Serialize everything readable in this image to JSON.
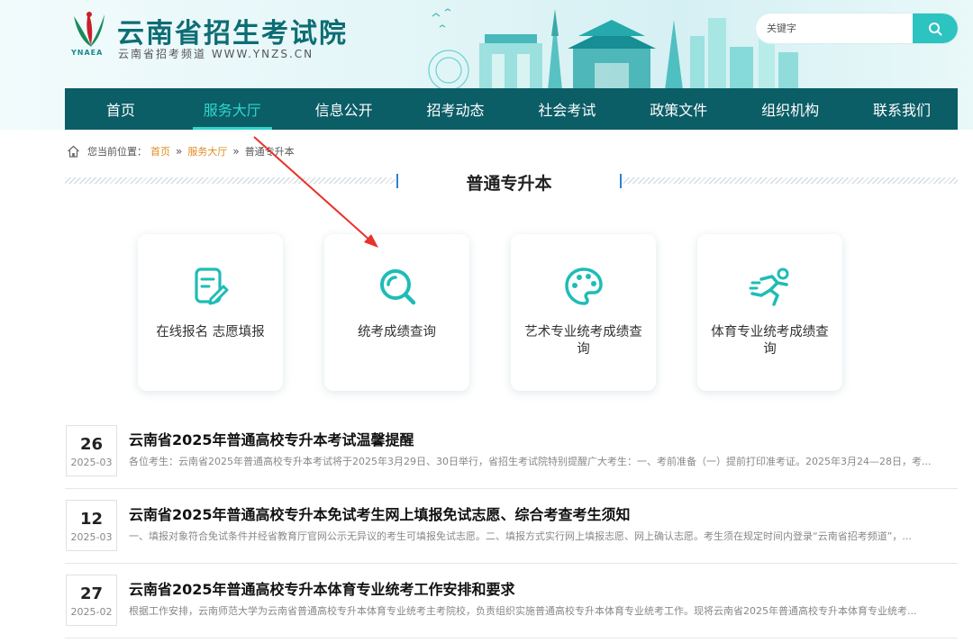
{
  "header": {
    "logo_text": "YNAEA",
    "site_title": "云南省招生考试院",
    "site_subtitle": "云南省招考频道 WWW.YNZS.CN",
    "search_placeholder": "关键字"
  },
  "nav": {
    "items": [
      {
        "label": "首页",
        "active": false
      },
      {
        "label": "服务大厅",
        "active": true
      },
      {
        "label": "信息公开",
        "active": false
      },
      {
        "label": "招考动态",
        "active": false
      },
      {
        "label": "社会考试",
        "active": false
      },
      {
        "label": "政策文件",
        "active": false
      },
      {
        "label": "组织机构",
        "active": false
      },
      {
        "label": "联系我们",
        "active": false
      }
    ]
  },
  "breadcrumb": {
    "prefix": "您当前位置：",
    "items": [
      "首页",
      "服务大厅",
      "普通专升本"
    ],
    "separator": "»"
  },
  "section": {
    "title": "普通专升本"
  },
  "cards": [
    {
      "label": "在线报名 志愿填报",
      "icon": "form-edit-icon"
    },
    {
      "label": "统考成绩查询",
      "icon": "search-icon"
    },
    {
      "label": "艺术专业统考成绩查询",
      "icon": "palette-icon"
    },
    {
      "label": "体育专业统考成绩查询",
      "icon": "runner-icon"
    }
  ],
  "news": [
    {
      "day": "26",
      "ym": "2025-03",
      "title": "云南省2025年普通高校专升本考试温馨提醒",
      "summary": "各位考生：云南省2025年普通高校专升本考试将于2025年3月29日、30日举行，省招生考试院特别提醒广大考生：一、考前准备（一）提前打印准考证。2025年3月24—28日，考..."
    },
    {
      "day": "12",
      "ym": "2025-03",
      "title": "云南省2025年普通高校专升本免试考生网上填报免试志愿、综合考查考生须知",
      "summary": "一、填报对象符合免试条件并经省教育厅官网公示无异议的考生可填报免试志愿。二、填报方式实行网上填报志愿、网上确认志愿。考生须在规定时间内登录“云南省招考频道”，..."
    },
    {
      "day": "27",
      "ym": "2025-02",
      "title": "云南省2025年普通高校专升本体育专业统考工作安排和要求",
      "summary": "根据工作安排，云南师范大学为云南省普通高校专升本体育专业统考主考院校，负责组织实施普通高校专升本体育专业统考工作。现将云南省2025年普通高校专升本体育专业统考..."
    }
  ],
  "colors": {
    "nav_bg": "#0b5d66",
    "nav_active": "#30d6cf",
    "accent_teal": "#1fbcb6",
    "breadcrumb_link": "#e08a1e",
    "annotation_arrow": "#e8322a"
  }
}
